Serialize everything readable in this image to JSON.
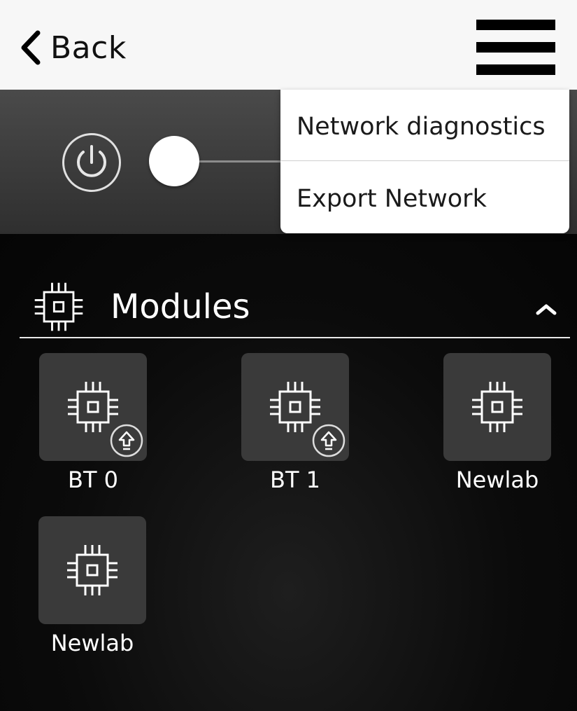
{
  "header": {
    "back_label": "Back",
    "menu_icon": "hamburger-menu-icon"
  },
  "power": {
    "icon": "power-icon",
    "toggle_state": "on"
  },
  "dropdown": {
    "items": [
      {
        "label": "Network diagnostics"
      },
      {
        "label": "Export Network"
      }
    ]
  },
  "modules": {
    "title": "Modules",
    "icon": "chip-icon",
    "collapse_icon": "chevron-up-icon",
    "items": [
      {
        "label": "BT 0",
        "badge": "update-arrow-icon"
      },
      {
        "label": "BT 1",
        "badge": "update-arrow-icon"
      },
      {
        "label": "Newlab",
        "badge": ""
      },
      {
        "label": "Newlab",
        "badge": ""
      }
    ]
  },
  "colors": {
    "topbar_bg": "#f7f7f7",
    "tile_bg": "#3a3a3a",
    "text_light": "#ffffff",
    "text_dark": "#111111"
  }
}
